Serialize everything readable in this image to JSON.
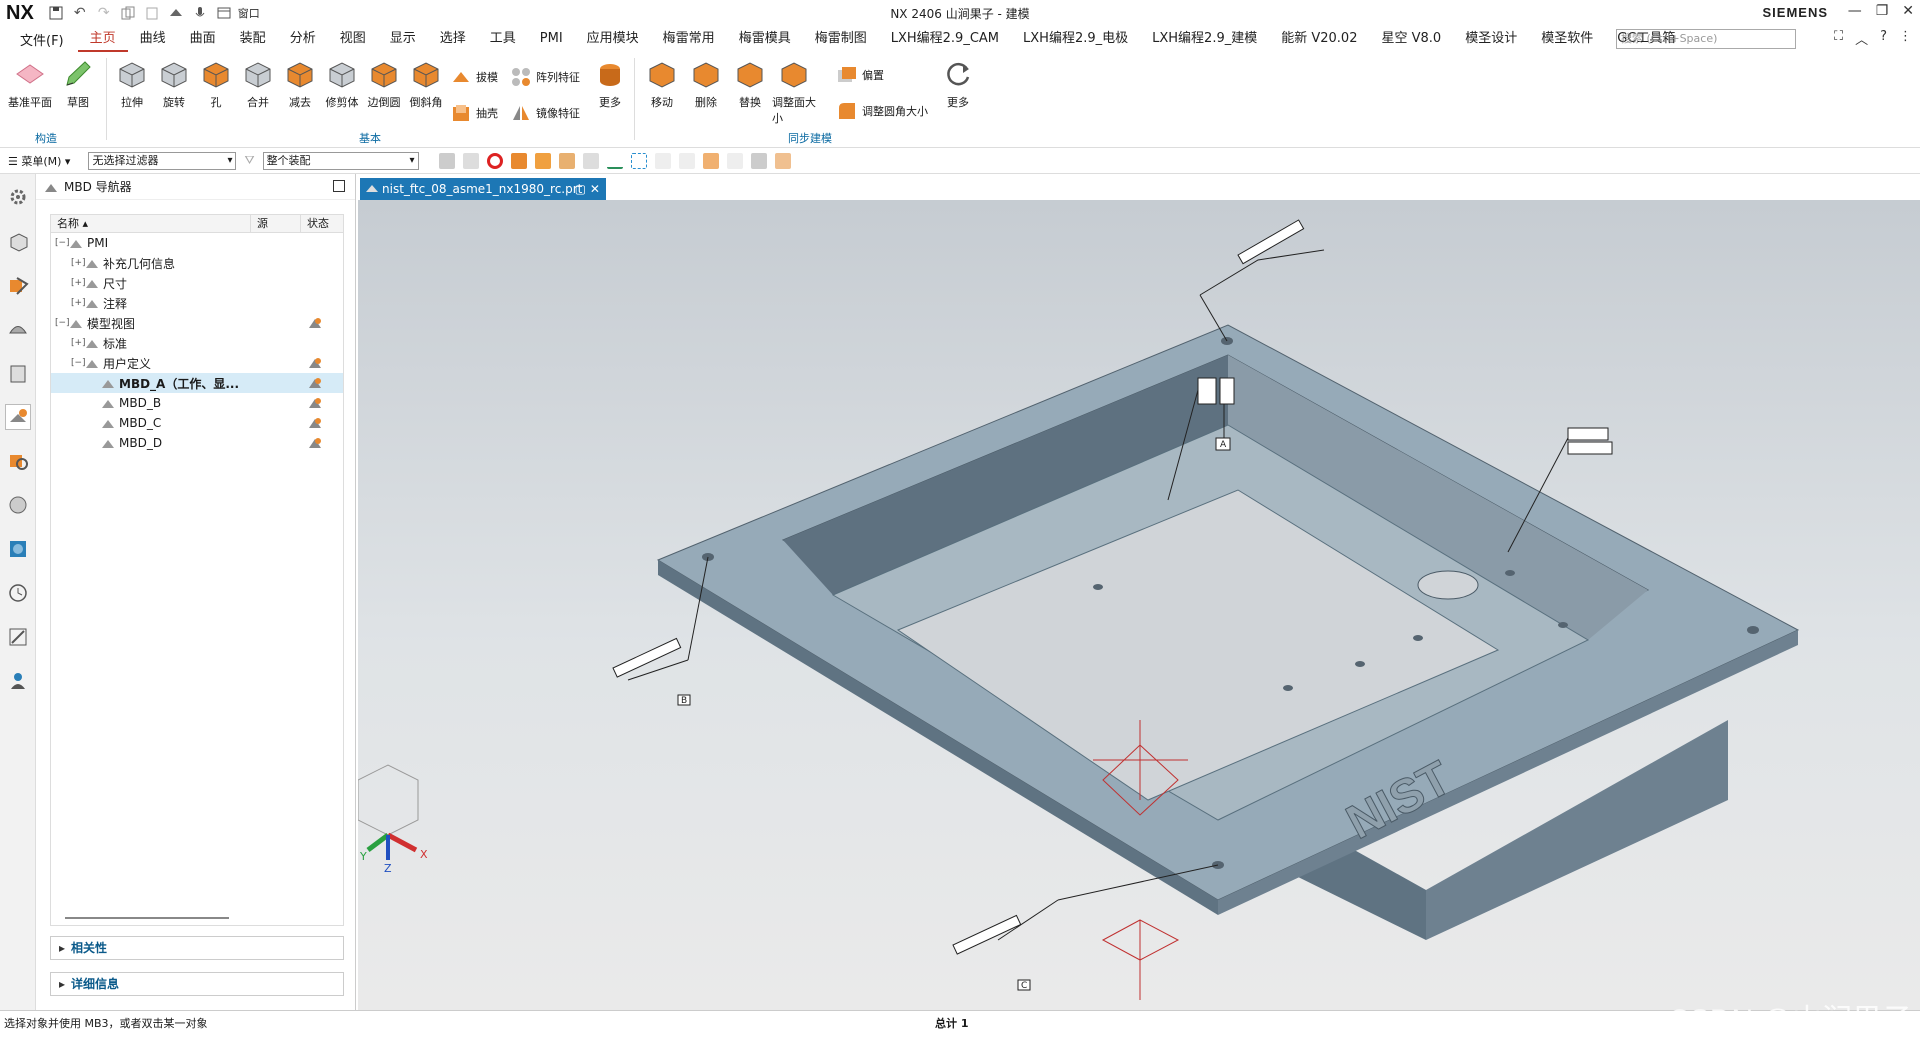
{
  "app": {
    "logo": "NX",
    "title": "NX 2406 山涧果子 - 建模",
    "brand": "SIEMENS",
    "window_menu_label": "窗口",
    "quick_access": [
      "save-icon",
      "undo-icon",
      "redo-icon",
      "copy-icon",
      "paste-icon",
      "snap-icon",
      "mic-icon",
      "window-icon"
    ]
  },
  "menu": {
    "file_label": "文件(F)",
    "tabs": [
      "主页",
      "曲线",
      "曲面",
      "装配",
      "分析",
      "视图",
      "显示",
      "选择",
      "工具",
      "PMI",
      "应用模块",
      "梅雷常用",
      "梅雷模具",
      "梅雷制图",
      "LXH编程2.9_CAM",
      "LXH编程2.9_电极",
      "LXH编程2.9_建模",
      "能新 V20.02",
      "星空 V8.0",
      "模圣设计",
      "模圣软件",
      "GC工具箱"
    ],
    "active_tab": "主页",
    "search_placeholder": "搜索 (Ctrl+Space)"
  },
  "ribbon": {
    "groups": [
      {
        "title": "构造"
      },
      {
        "title": "基本"
      },
      {
        "title": "同步建模"
      }
    ],
    "construct": [
      {
        "label": "基准平面"
      },
      {
        "label": "草图"
      }
    ],
    "basic": [
      {
        "label": "拉伸"
      },
      {
        "label": "旋转"
      },
      {
        "label": "孔"
      },
      {
        "label": "合并"
      },
      {
        "label": "减去"
      },
      {
        "label": "修剪体"
      },
      {
        "label": "边倒圆"
      },
      {
        "label": "倒斜角"
      }
    ],
    "basic_small": [
      {
        "label": "拔模"
      },
      {
        "label": "阵列特征"
      },
      {
        "label": "抽壳"
      },
      {
        "label": "镜像特征"
      }
    ],
    "basic_more": "更多",
    "sync": [
      {
        "label": "移动"
      },
      {
        "label": "删除"
      },
      {
        "label": "替换"
      },
      {
        "label": "调整面大小"
      }
    ],
    "sync_small": [
      {
        "label": "偏置"
      },
      {
        "label": "调整圆角大小"
      }
    ],
    "sync_more": "更多"
  },
  "selection_bar": {
    "menu_label": "菜单(M)",
    "filter_value": "无选择过滤器",
    "scope_value": "整个装配"
  },
  "navigator": {
    "title": "MBD 导航器",
    "columns": [
      "名称",
      "源",
      "状态"
    ],
    "rows": [
      {
        "label": "PMI",
        "level": 0,
        "toggle": "−",
        "state": false
      },
      {
        "label": "补充几何信息",
        "level": 1,
        "toggle": "+",
        "state": false
      },
      {
        "label": "尺寸",
        "level": 1,
        "toggle": "+",
        "state": false
      },
      {
        "label": "注释",
        "level": 1,
        "toggle": "+",
        "state": false
      },
      {
        "label": "模型视图",
        "level": 0,
        "toggle": "−",
        "state": true
      },
      {
        "label": "标准",
        "level": 1,
        "toggle": "+",
        "state": false
      },
      {
        "label": "用户定义",
        "level": 1,
        "toggle": "−",
        "state": true
      },
      {
        "label": "MBD_A（工作、显...",
        "level": 2,
        "toggle": "",
        "state": true,
        "selected": true
      },
      {
        "label": "MBD_B",
        "level": 2,
        "toggle": "",
        "state": true
      },
      {
        "label": "MBD_C",
        "level": 2,
        "toggle": "",
        "state": true
      },
      {
        "label": "MBD_D",
        "level": 2,
        "toggle": "",
        "state": true
      }
    ],
    "panels": [
      "相关性",
      "详细信息"
    ]
  },
  "document": {
    "tab_label": "nist_ftc_08_asme1_nx1980_rc.prt"
  },
  "viewport": {
    "triad": {
      "x": "X",
      "y": "Y",
      "z": "Z"
    },
    "datum_labels": [
      "A",
      "B",
      "C"
    ],
    "part_text": "NIST"
  },
  "status": {
    "left": "选择对象并使用 MB3，或者双击某一对象",
    "center": "总计 1",
    "watermark": "CSDN @山涧果子"
  },
  "colors": {
    "accent_tab": "#c0392b",
    "doc_tab": "#1d77b5",
    "part_face": "#8fa3b2",
    "part_side": "#6e8190"
  }
}
